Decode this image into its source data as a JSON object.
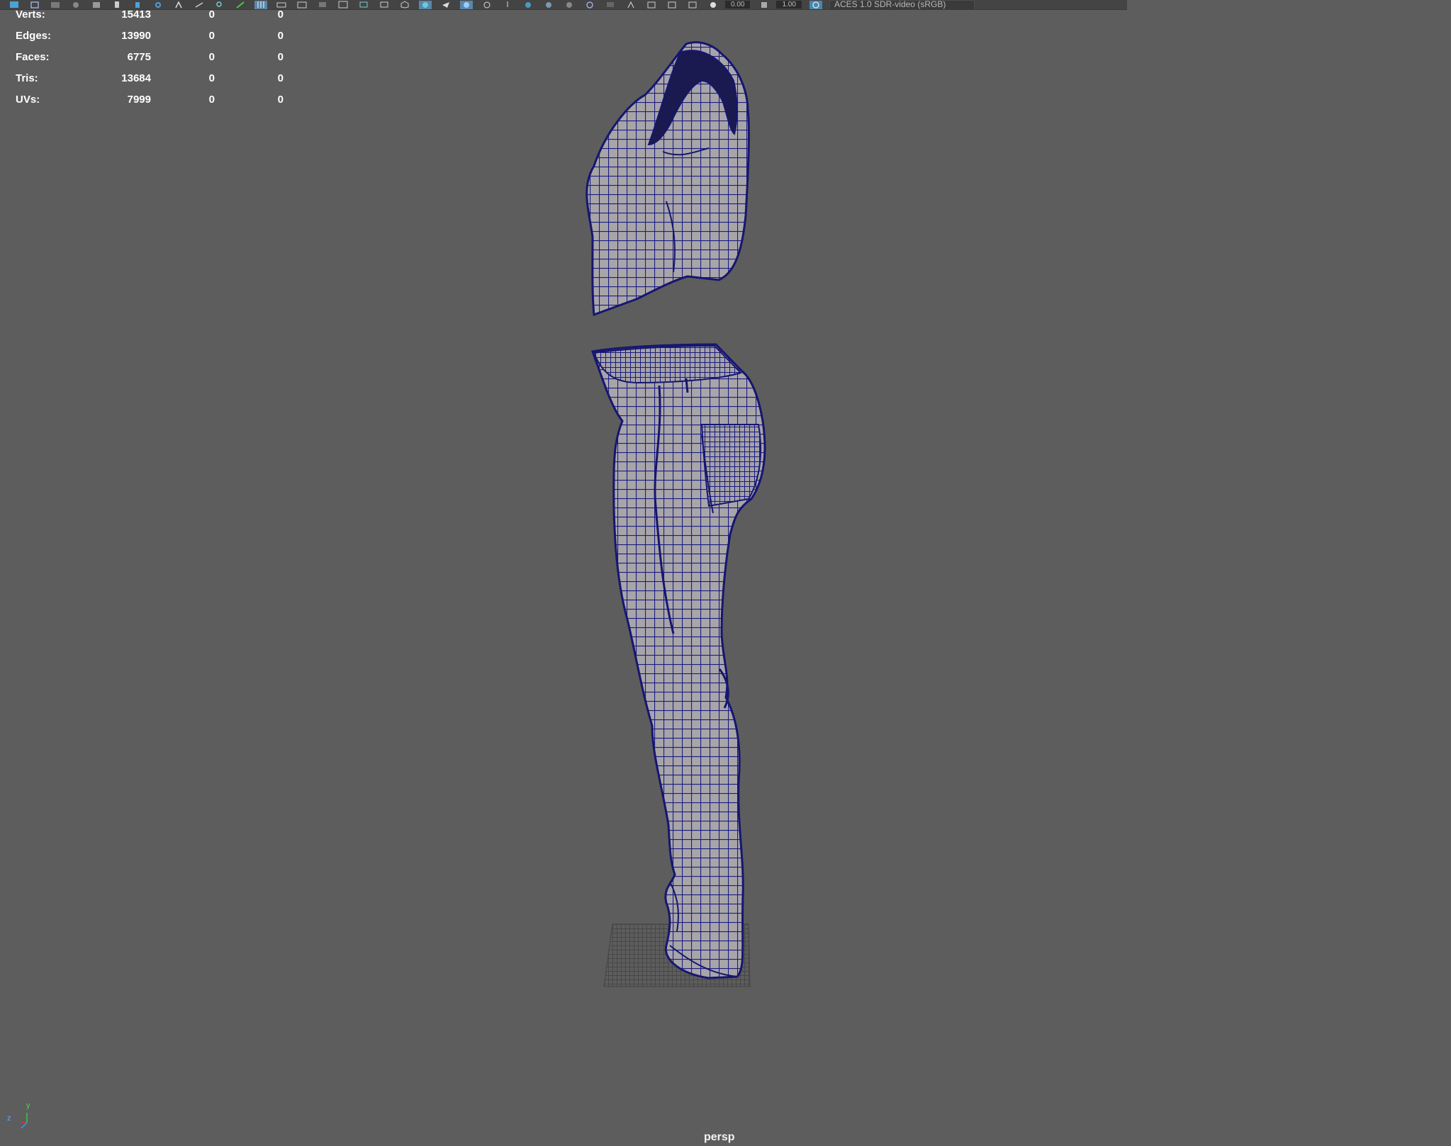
{
  "toolbar": {
    "icons": [
      "select-icon",
      "lasso-icon",
      "paint-icon",
      "grid-icon",
      "camera-icon",
      "bookmark-icon",
      "image-plane-icon",
      "pin-icon",
      "sun-icon",
      "move-icon",
      "zoom-icon",
      "pan-icon",
      "grid-toggle-icon",
      "film-gate-icon",
      "resolution-gate-icon",
      "gate-mask-icon",
      "field-chart-icon",
      "safe-action-icon",
      "safe-title-icon",
      "wireframe-icon",
      "smooth-shade-icon",
      "default-material-icon",
      "textured-icon",
      "lights-icon",
      "shadows-icon",
      "ao-icon",
      "motion-blur-icon",
      "aa-icon",
      "depth-of-field-icon",
      "isolate-icon",
      "xray-icon",
      "xray-joints-icon",
      "xray-active-icon",
      "backface-icon",
      "exposure-icon",
      "gamma-icon",
      "color-management-icon"
    ],
    "exposure_value": "0.00",
    "gamma_value": "1.00",
    "color_space": "ACES 1.0 SDR-video (sRGB)"
  },
  "hud": {
    "rows": [
      {
        "label": "Verts:",
        "object": "15413",
        "selected": "0",
        "component": "0"
      },
      {
        "label": "Edges:",
        "object": "13990",
        "selected": "0",
        "component": "0"
      },
      {
        "label": "Faces:",
        "object": "6775",
        "selected": "0",
        "component": "0"
      },
      {
        "label": "Tris:",
        "object": "13684",
        "selected": "0",
        "component": "0"
      },
      {
        "label": "UVs:",
        "object": "7999",
        "selected": "0",
        "component": "0"
      }
    ]
  },
  "viewport": {
    "camera": "persp",
    "background": "#5d5d5d",
    "wireframe_color": "#1a1a7a",
    "mesh_color": "#a9a6a8",
    "axis": {
      "y": "y",
      "z": "z"
    }
  }
}
